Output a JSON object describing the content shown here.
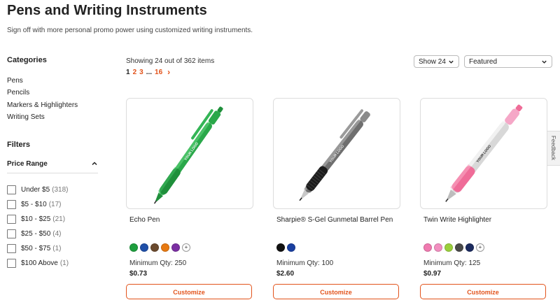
{
  "page": {
    "title": "Pens and Writing Instruments",
    "subtitle": "Sign off with more personal promo power using customized writing instruments."
  },
  "sidebar": {
    "categories_title": "Categories",
    "categories": [
      "Pens",
      "Pencils",
      "Markers & Highlighters",
      "Writing Sets"
    ],
    "filters_title": "Filters",
    "price_range_title": "Price Range",
    "price_options": [
      {
        "label": "Under $5",
        "count": "(318)"
      },
      {
        "label": "$5 - $10",
        "count": "(17)"
      },
      {
        "label": "$10 - $25",
        "count": "(21)"
      },
      {
        "label": "$25 - $50",
        "count": "(4)"
      },
      {
        "label": "$50 - $75",
        "count": "(1)"
      },
      {
        "label": "$100 Above",
        "count": "(1)"
      }
    ]
  },
  "results": {
    "showing": "Showing 24 out of 362 items",
    "pages": {
      "current": "1",
      "p2": "2",
      "p3": "3",
      "ellipsis": "...",
      "last": "16",
      "next": "›"
    }
  },
  "controls": {
    "per_page": "Show 24",
    "sort": "Featured"
  },
  "feedback_label": "Feedback",
  "products": [
    {
      "name": "Echo Pen",
      "min_qty": "Minimum Qty: 250",
      "price": "$0.73",
      "cta": "Customize",
      "logo_text": "YOUR LOGO",
      "swatches": [
        "#1e9e3e",
        "#1f4fa8",
        "#6b4a2e",
        "#e87a12",
        "#7b2fa2"
      ],
      "has_more": true
    },
    {
      "name": "Sharpie® S-Gel Gunmetal Barrel Pen",
      "min_qty": "Minimum Qty: 100",
      "price": "$2.60",
      "cta": "Customize",
      "logo_text": "YOUR LOGO",
      "swatches": [
        "#111111",
        "#1a3fa0"
      ],
      "has_more": false
    },
    {
      "name": "Twin Write Highlighter",
      "min_qty": "Minimum Qty: 125",
      "price": "$0.97",
      "cta": "Customize",
      "logo_text": "YOUR LOGO",
      "swatches": [
        "#f07ab0",
        "#f28fc0",
        "#9bcf3c",
        "#4a4a4a",
        "#1b2a5e"
      ],
      "has_more": true
    }
  ],
  "more_symbol": "+"
}
